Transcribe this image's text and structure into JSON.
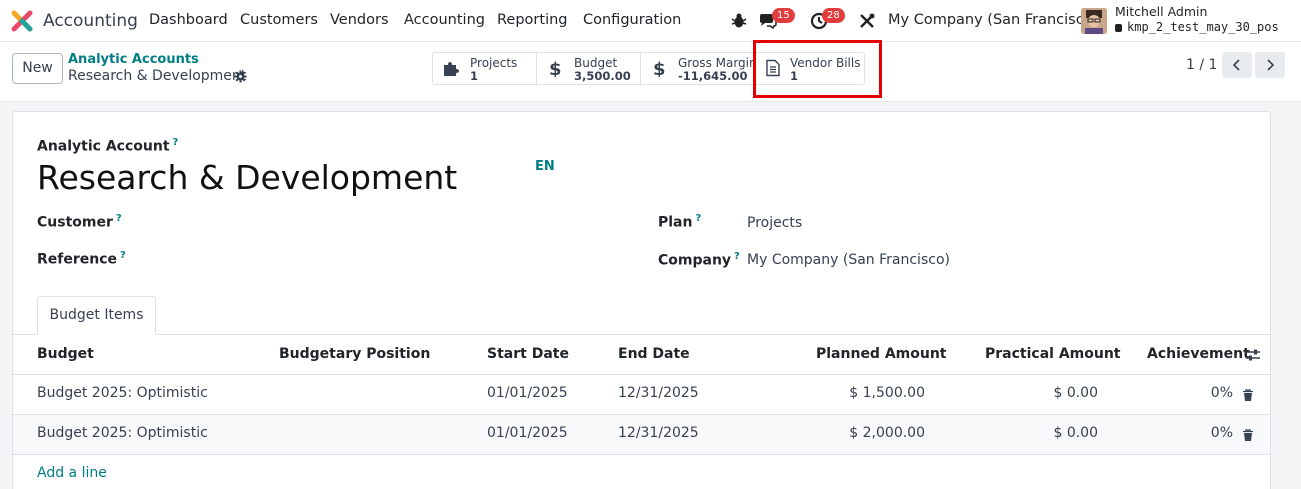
{
  "topbar": {
    "app_name": "Accounting",
    "menu": [
      "Dashboard",
      "Customers",
      "Vendors",
      "Accounting",
      "Reporting",
      "Configuration"
    ],
    "messages_badge": "15",
    "activities_badge": "28",
    "company": "My Company (San Francisco)",
    "user_name": "Mitchell Admin",
    "database": "kmp_2_test_may_30_pos"
  },
  "controlbar": {
    "new_label": "New",
    "breadcrumb_parent": "Analytic Accounts",
    "breadcrumb_current": "Research & Development",
    "pager": "1 / 1",
    "smart_buttons": [
      {
        "label": "Projects",
        "value": "1",
        "icon": "puzzle-icon"
      },
      {
        "label": "Budget",
        "value": "3,500.00",
        "icon": "dollar-icon"
      },
      {
        "label": "Gross Margin",
        "value": "-11,645.00",
        "icon": "dollar-icon"
      },
      {
        "label": "Vendor Bills",
        "value": "1",
        "icon": "document-icon"
      }
    ],
    "highlight_color": "#e40000"
  },
  "form": {
    "name_label": "Analytic Account",
    "name": "Research & Development",
    "lang": "EN",
    "customer_label": "Customer",
    "reference_label": "Reference",
    "plan_label": "Plan",
    "plan_value": "Projects",
    "company_label": "Company",
    "company_value": "My Company (San Francisco)",
    "tooltip_mark": "?"
  },
  "budget_tab": {
    "tab_label": "Budget Items",
    "columns": [
      "Budget",
      "Budgetary Position",
      "Start Date",
      "End Date",
      "Planned Amount",
      "Practical Amount",
      "Achievement"
    ],
    "rows": [
      {
        "budget": "Budget 2025: Optimistic",
        "position": "",
        "start": "01/01/2025",
        "end": "12/31/2025",
        "planned": "$ 1,500.00",
        "practical": "$ 0.00",
        "achievement": "0%"
      },
      {
        "budget": "Budget 2025: Optimistic",
        "position": "",
        "start": "01/01/2025",
        "end": "12/31/2025",
        "planned": "$ 2,000.00",
        "practical": "$ 0.00",
        "achievement": "0%"
      }
    ],
    "add_line": "Add a line"
  },
  "colors": {
    "accent": "#017e84",
    "badge": "#e23d3d"
  }
}
